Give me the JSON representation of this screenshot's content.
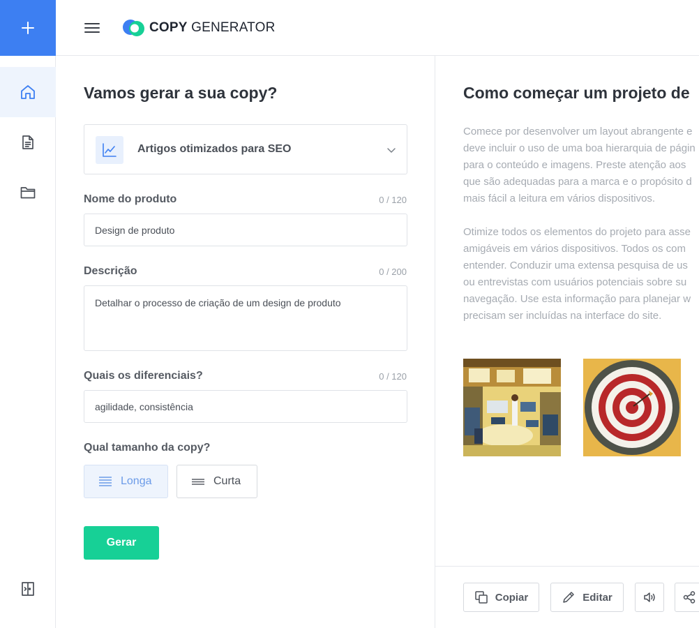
{
  "app": {
    "logo_bold": "COPY",
    "logo_regular": " GENERATOR"
  },
  "sidebar": {
    "items": [
      {
        "icon": "home-icon",
        "active": true
      },
      {
        "icon": "document-icon",
        "active": false
      },
      {
        "icon": "folder-icon",
        "active": false
      }
    ],
    "bottom_icon": "door-exit-icon"
  },
  "form": {
    "title": "Vamos gerar a sua copy?",
    "template_select": {
      "icon": "line-chart-icon",
      "value": "Artigos otimizados para SEO"
    },
    "fields": [
      {
        "label": "Nome do produto",
        "count": "0 / 120",
        "value": "Design de produto"
      },
      {
        "label": "Descrição",
        "count": "0 / 200",
        "value": "Detalhar o processo de criação de um design de produto"
      },
      {
        "label": "Quais os diferenciais?",
        "count": "0 / 120",
        "value": "agilidade, consistência"
      }
    ],
    "size_label": "Qual tamanho da copy?",
    "size_options": [
      {
        "label": "Longa",
        "selected": true
      },
      {
        "label": "Curta",
        "selected": false
      }
    ],
    "generate_label": "Gerar"
  },
  "preview": {
    "title": "Como começar um projeto de",
    "paragraph1": [
      "Comece por desenvolver um layout abrangente e",
      "deve incluir o uso de uma boa hierarquia de págin",
      "para o conteúdo e imagens. Preste atenção aos",
      "que são adequadas para a marca e o propósito d",
      "mais fácil a leitura em vários dispositivos."
    ],
    "paragraph2": [
      "Otimize todos os elementos do projeto para asse",
      "amigáveis em vários dispositivos. Todos os com",
      "entender. Conduzir uma extensa pesquisa de us",
      "ou entrevistas com usuários potenciais sobre su",
      "navegação. Use esta informação para planejar w",
      "precisam ser incluídas na interface do site."
    ],
    "images": [
      "office-painting",
      "dartboard-painting"
    ],
    "toolbar": {
      "copy_label": "Copiar",
      "edit_label": "Editar"
    }
  },
  "colors": {
    "primary": "#3d7ff2",
    "accent_green": "#17d096",
    "active_bg": "#eef4fd"
  }
}
